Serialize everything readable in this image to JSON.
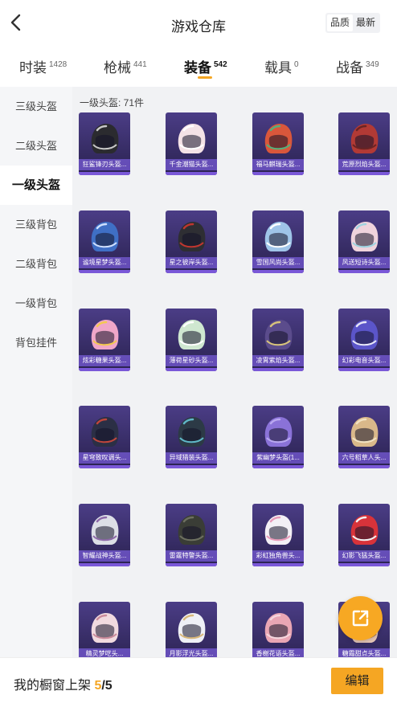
{
  "header": {
    "title": "游戏仓库",
    "sort_options": [
      {
        "label": "品质",
        "active": true
      },
      {
        "label": "最新",
        "active": false
      }
    ]
  },
  "tabs": [
    {
      "label": "时装",
      "count": "1428",
      "active": false
    },
    {
      "label": "枪械",
      "count": "441",
      "active": false
    },
    {
      "label": "装备",
      "count": "542",
      "active": true
    },
    {
      "label": "载具",
      "count": "0",
      "active": false
    },
    {
      "label": "战备",
      "count": "349",
      "active": false
    }
  ],
  "sidebar": {
    "items": [
      {
        "label": "三级头盔",
        "active": false
      },
      {
        "label": "二级头盔",
        "active": false
      },
      {
        "label": "一级头盔",
        "active": true
      },
      {
        "label": "三级背包",
        "active": false
      },
      {
        "label": "二级背包",
        "active": false
      },
      {
        "label": "一级背包",
        "active": false
      },
      {
        "label": "背包挂件",
        "active": false
      }
    ]
  },
  "content": {
    "section_title": "一级头盔: 71件",
    "items": [
      {
        "name": "狂鲨锋刃头盔...",
        "color": "#2b2b2f",
        "accent": "#c8c8c8"
      },
      {
        "name": "千金潮猫头盔...",
        "color": "#f4e2e6",
        "accent": "#ffffff"
      },
      {
        "name": "福马麒瑞头盔...",
        "color": "#d9573b",
        "accent": "#55b07a"
      },
      {
        "name": "荒原烈焰头盔...",
        "color": "#b23a35",
        "accent": "#6a2424"
      },
      {
        "name": "谧境星梦头盔...",
        "color": "#3f6fc5",
        "accent": "#cfe0ff"
      },
      {
        "name": "星之彼岸头盔...",
        "color": "#2e2e33",
        "accent": "#c0362f"
      },
      {
        "name": "雪国风尚头盔...",
        "color": "#9fc4e8",
        "accent": "#ffffff"
      },
      {
        "name": "风送短诗头盔...",
        "color": "#efd3dc",
        "accent": "#9fd3e0"
      },
      {
        "name": "炫彩糖果头盔...",
        "color": "#f0a6c8",
        "accent": "#f3c94e"
      },
      {
        "name": "薄荷星砂头盔...",
        "color": "#cfe7d0",
        "accent": "#ffffff"
      },
      {
        "name": "凌霄紫焰头盔...",
        "color": "#5b4c8c",
        "accent": "#d8c47a"
      },
      {
        "name": "幻彩电音头盔...",
        "color": "#5b55c9",
        "accent": "#e8e8f8"
      },
      {
        "name": "星穹致叹调头...",
        "color": "#2b2f45",
        "accent": "#c0463c"
      },
      {
        "name": "异域猎装头盔...",
        "color": "#2c3a46",
        "accent": "#5fb7c7"
      },
      {
        "name": "紫幽梦头盔(1...",
        "color": "#8a72d8",
        "accent": "#b9a8f0"
      },
      {
        "name": "六号稻草人头...",
        "color": "#d9b88a",
        "accent": "#f2e2c2"
      },
      {
        "name": "智耀战神头盔...",
        "color": "#dcdfe6",
        "accent": "#8d6aa8"
      },
      {
        "name": "雷霆特警头盔...",
        "color": "#3a3d36",
        "accent": "#6d7060"
      },
      {
        "name": "彩虹独角兽头...",
        "color": "#f3f0f5",
        "accent": "#e89ab8"
      },
      {
        "name": "幻影飞猛头盔...",
        "color": "#d8333a",
        "accent": "#f2f2f2"
      },
      {
        "name": "精灵梦呓头...",
        "color": "#f1dadf",
        "accent": "#c98a9a"
      },
      {
        "name": "月影浮光头盔...",
        "color": "#eef0f6",
        "accent": "#d8b87a"
      },
      {
        "name": "香榭花语头盔...",
        "color": "#e9a6b4",
        "accent": "#f6d7de"
      },
      {
        "name": "糖霜甜点头盔...",
        "color": "#e9c8b8",
        "accent": "#b08060"
      }
    ]
  },
  "bottom": {
    "prefix": "我的橱窗上架 ",
    "current": "5",
    "total": "/5",
    "edit_label": "编辑"
  },
  "colors": {
    "accent": "#f5a623",
    "card_bg": "#3a2f6e"
  },
  "icons": {
    "back": "chevron-left-icon",
    "share": "external-link-icon"
  }
}
